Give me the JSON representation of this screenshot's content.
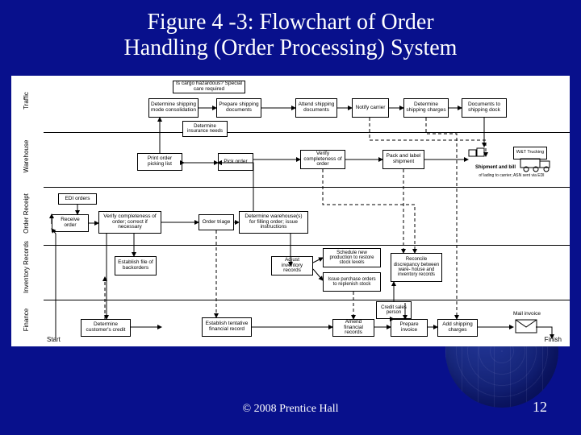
{
  "title_line1": "Figure 4 -3:  Flowchart of Order",
  "title_line2": "Handling (Order Processing) System",
  "footer": "© 2008 Prentice Hall",
  "page": "12",
  "lanes": {
    "traffic": "Traffic",
    "warehouse": "Warehouse",
    "order_receipt": "Order Receipt",
    "inventory": "Inventory Records",
    "finance": "Finance"
  },
  "start": "Start",
  "finish": "Finish",
  "nodes": {
    "t1": "Is cargo hazardous? Special care required",
    "t2": "Determine shipping mode consolidation",
    "t3": "Prepare shipping documents",
    "t4": "Determine insurance needs",
    "t5": "Attend shipping documents",
    "t6": "Notify carrier",
    "t7": "Determine shipping charges",
    "t8": "Documents to shipping dock",
    "w1": "Print order picking list",
    "w2": "Pick order",
    "w3": "Verify completeness of order",
    "w4": "Pack and label shipment",
    "w5": "Shipment and bill",
    "w6": "of lading to carrier; ASN sent via EDI",
    "w7": "W&T Trucking",
    "or0": "EDI orders",
    "or1": "Receive order",
    "or2": "Verify completeness of order; correct if necessary",
    "or3": "Order triage",
    "or4": "Determine warehouse(s) for filling order; issue instructions",
    "inv1": "Establish file of backorders",
    "inv2": "Adjust inventory records",
    "inv3": "Schedule new production to restore stock levels",
    "inv4": "Issue purchase orders to replenish stock",
    "inv5": "Reconcile discrepancy between ware- house and inventory records",
    "fin0": "Credit sales person",
    "fin1": "Determine customer's credit",
    "fin2": "Establish tentative financial record",
    "fin3": "Amend financial records",
    "fin4": "Prepare invoice",
    "fin5": "Add shipping charges",
    "fin6": "Mail invoice"
  }
}
